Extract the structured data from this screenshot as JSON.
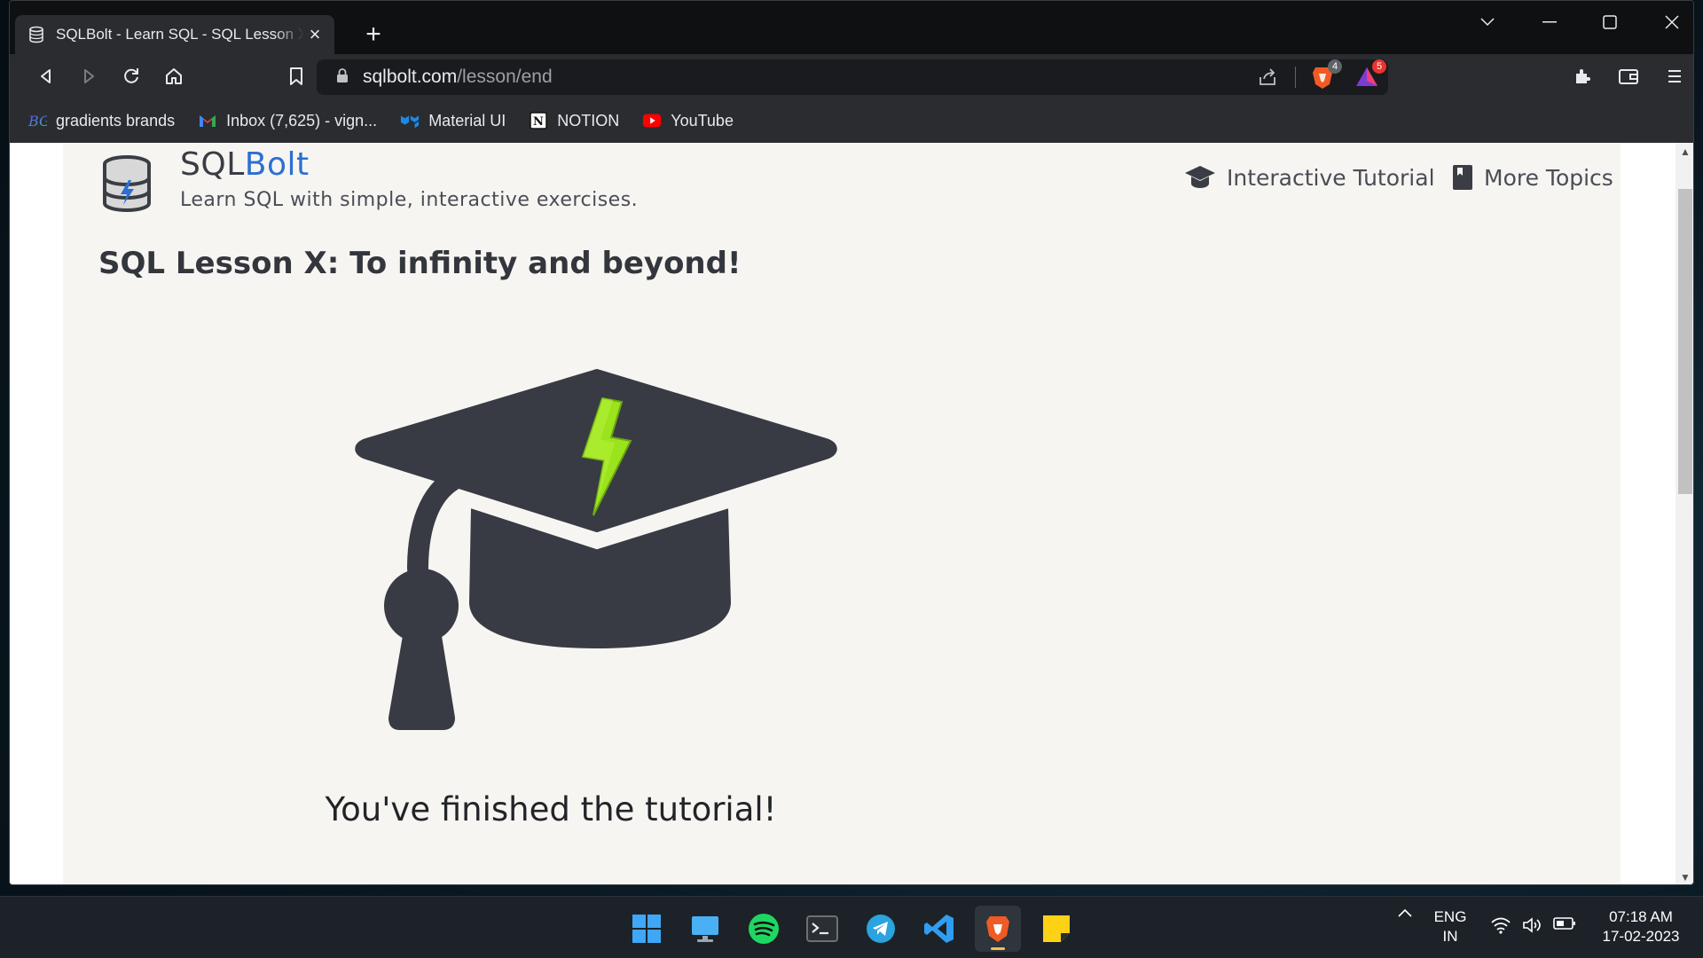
{
  "browser": {
    "tab_title": "SQLBolt - Learn SQL - SQL Lesson X: To infinity and beyond!",
    "url_host": "sqlbolt.com",
    "url_path": "/lesson/end",
    "shield_badge": "4",
    "rewards_badge": "5",
    "bookmarks": [
      {
        "label": "gradients brands",
        "icon": "gradients-icon"
      },
      {
        "label": "Inbox (7,625) - vign...",
        "icon": "gmail-icon"
      },
      {
        "label": "Material UI",
        "icon": "material-ui-icon"
      },
      {
        "label": "NOTION",
        "icon": "notion-icon"
      },
      {
        "label": "YouTube",
        "icon": "youtube-icon"
      }
    ]
  },
  "site": {
    "brand_prefix": "SQL",
    "brand_suffix": "Bolt",
    "tagline": "Learn SQL with simple, interactive exercises.",
    "nav": {
      "tutorial": "Interactive Tutorial",
      "topics": "More Topics"
    },
    "lesson_title": "SQL Lesson X: To infinity and beyond!",
    "finished_text": "You've finished the tutorial!"
  },
  "taskbar": {
    "apps": [
      "windows-start-icon",
      "desktop-icon",
      "spotify-icon",
      "terminal-icon",
      "telegram-icon",
      "vscode-icon",
      "brave-icon",
      "sticky-notes-icon"
    ],
    "lang_top": "ENG",
    "lang_bottom": "IN",
    "time": "07:18 AM",
    "date": "17-02-2023"
  },
  "colors": {
    "brand_blue": "#2c6fd1",
    "page_bg": "#f7f5f2",
    "cap_dark": "#383b43",
    "bolt_green": "#9be31c"
  }
}
